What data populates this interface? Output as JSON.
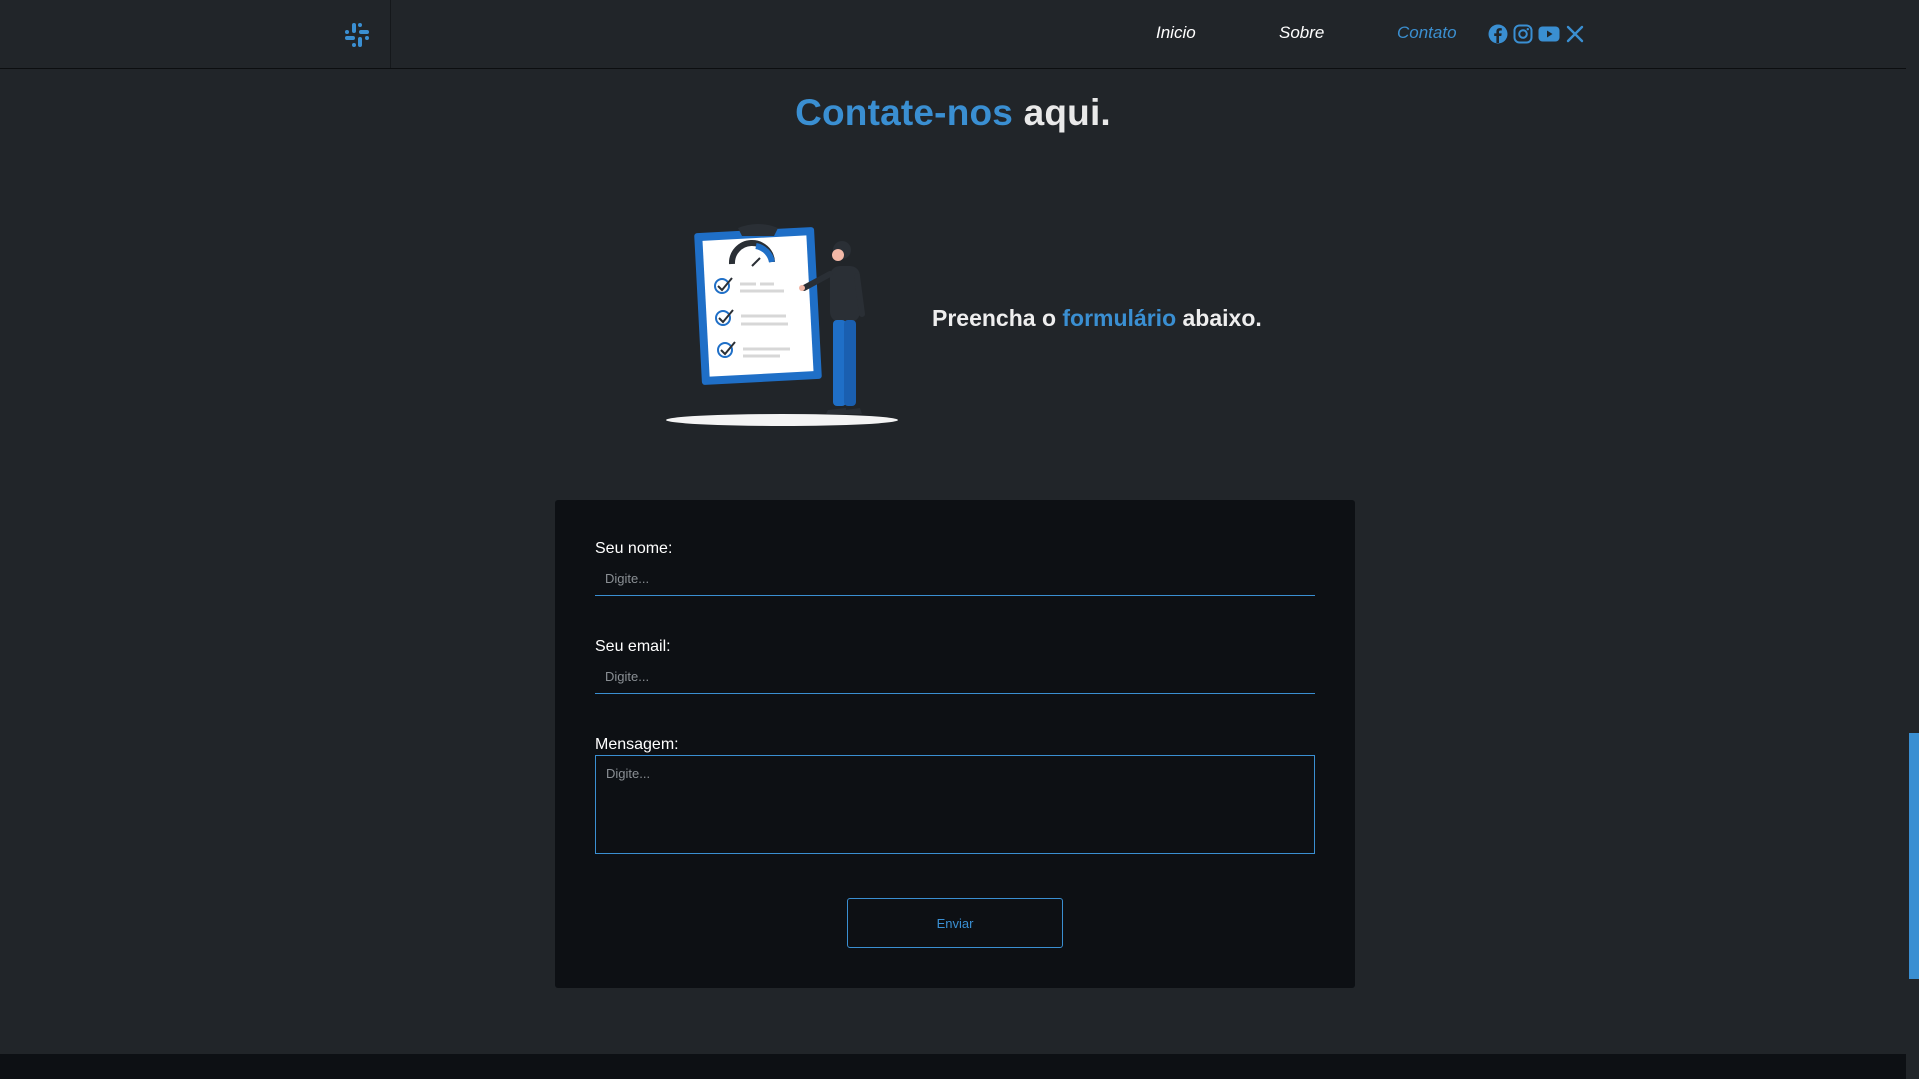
{
  "nav": {
    "brand_icon": "slack-icon",
    "links": [
      "Inicio",
      "Sobre",
      "Contato"
    ],
    "active_link": "Contato",
    "socials": [
      "facebook-icon",
      "instagram-icon",
      "youtube-icon",
      "x-icon"
    ]
  },
  "heading": {
    "accent": "Contate-nos",
    "rest": " aqui."
  },
  "subheading": {
    "before": "Preencha o ",
    "accent": "formulário",
    "after": " abaixo."
  },
  "form": {
    "name_label": "Seu nome:",
    "name_placeholder": "Digite...",
    "email_label": "Seu email:",
    "email_placeholder": "Digite...",
    "message_label": "Mensagem:",
    "message_placeholder": "Digite...",
    "submit_label": "Enviar"
  },
  "colors": {
    "accent": "#3a8fd2",
    "background": "#212529",
    "card": "#0d1014"
  }
}
